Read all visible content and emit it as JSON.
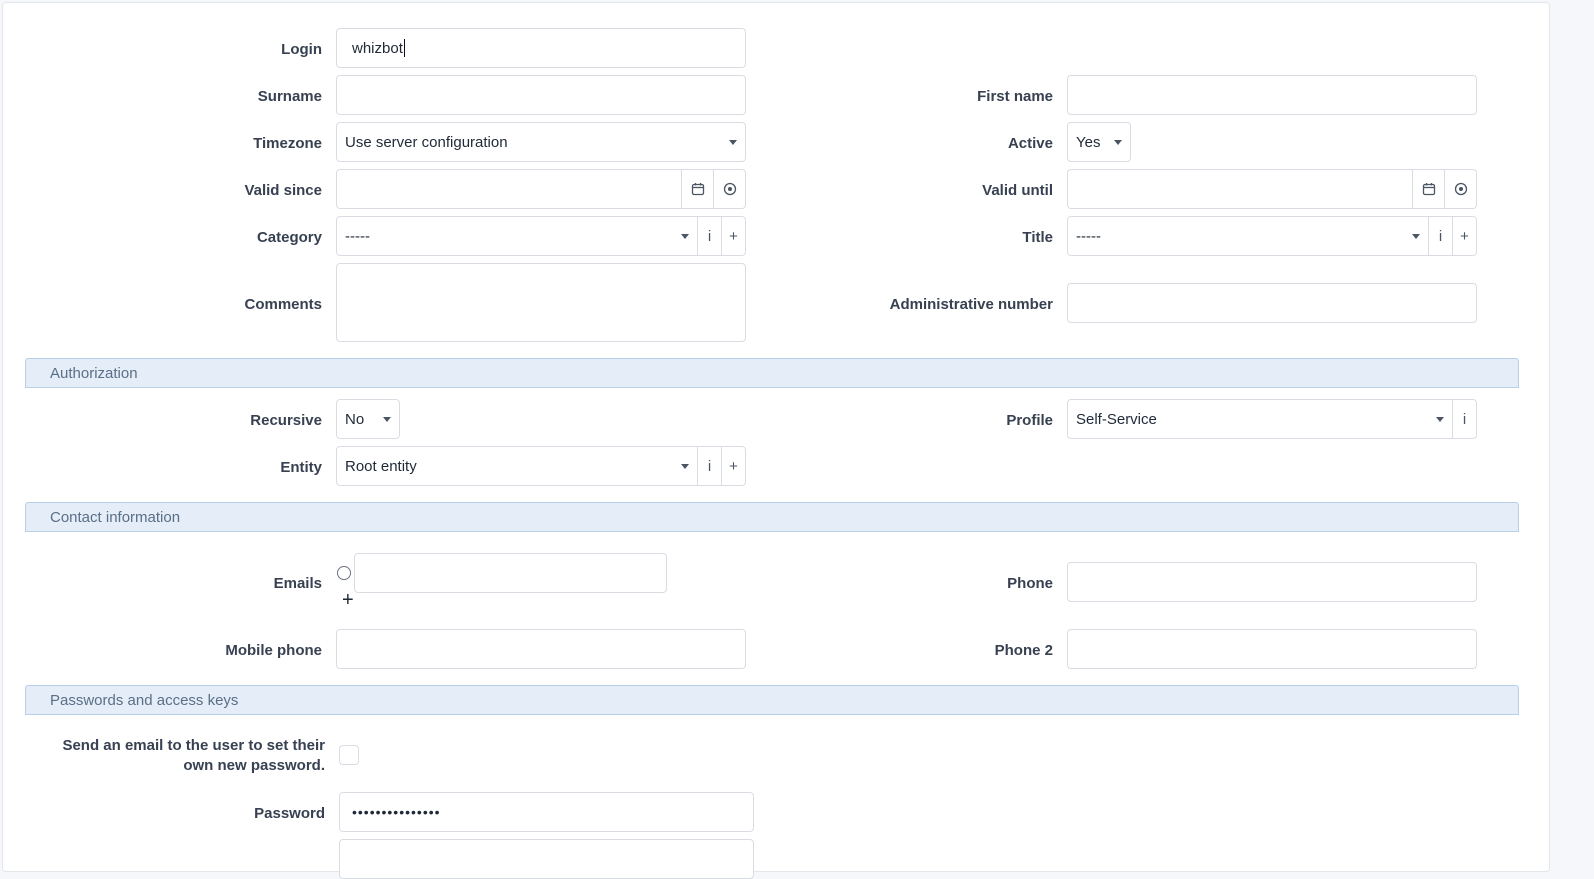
{
  "fields": {
    "login": {
      "label": "Login",
      "value": "whizbot"
    },
    "surname": {
      "label": "Surname",
      "value": ""
    },
    "first_name": {
      "label": "First name",
      "value": ""
    },
    "timezone": {
      "label": "Timezone",
      "value": "Use server configuration"
    },
    "active": {
      "label": "Active",
      "value": "Yes"
    },
    "valid_since": {
      "label": "Valid since",
      "value": ""
    },
    "valid_until": {
      "label": "Valid until",
      "value": ""
    },
    "category": {
      "label": "Category",
      "value": "-----"
    },
    "title": {
      "label": "Title",
      "value": "-----"
    },
    "comments": {
      "label": "Comments",
      "value": ""
    },
    "administrative_number": {
      "label": "Administrative number",
      "value": ""
    }
  },
  "authorization": {
    "header": "Authorization",
    "recursive": {
      "label": "Recursive",
      "value": "No"
    },
    "profile": {
      "label": "Profile",
      "value": "Self-Service"
    },
    "entity": {
      "label": "Entity",
      "value": "Root entity"
    }
  },
  "contact": {
    "header": "Contact information",
    "emails": {
      "label": "Emails",
      "value": ""
    },
    "phone": {
      "label": "Phone",
      "value": ""
    },
    "mobile_phone": {
      "label": "Mobile phone",
      "value": ""
    },
    "phone2": {
      "label": "Phone 2",
      "value": ""
    }
  },
  "passwords": {
    "header": "Passwords and access keys",
    "send_email_label": "Send an email to the user to set their own new password.",
    "password": {
      "label": "Password",
      "value": "•••••••••••••••"
    }
  },
  "icons": {
    "info": "i",
    "plus": "+",
    "calendar": "calendar-icon",
    "clear": "clear-icon"
  }
}
